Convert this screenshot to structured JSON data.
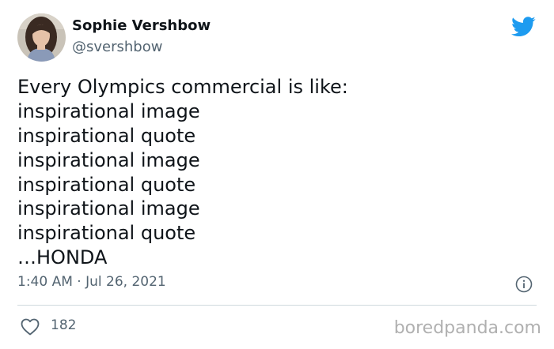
{
  "author": {
    "display_name": "Sophie Vershbow",
    "handle": "@svershbow",
    "avatar_icon": "user-avatar-photo"
  },
  "brand": {
    "logo_icon": "twitter-bird-icon",
    "color": "#1d9bf0"
  },
  "tweet": {
    "lines": [
      "Every Olympics commercial is like:",
      "inspirational image",
      "inspirational quote",
      "inspirational image",
      "inspirational quote",
      "inspirational image",
      "inspirational quote",
      "…HONDA"
    ],
    "timestamp": "1:40 AM · Jul 26, 2021",
    "info_icon": "info-icon"
  },
  "engagement": {
    "like_icon": "heart-icon",
    "like_count": "182"
  },
  "watermark": {
    "text": "boredpanda.com"
  },
  "colors": {
    "text_primary": "#0f1419",
    "text_secondary": "#536471",
    "divider": "#cfd9de",
    "watermark": "#b0b0b0"
  }
}
